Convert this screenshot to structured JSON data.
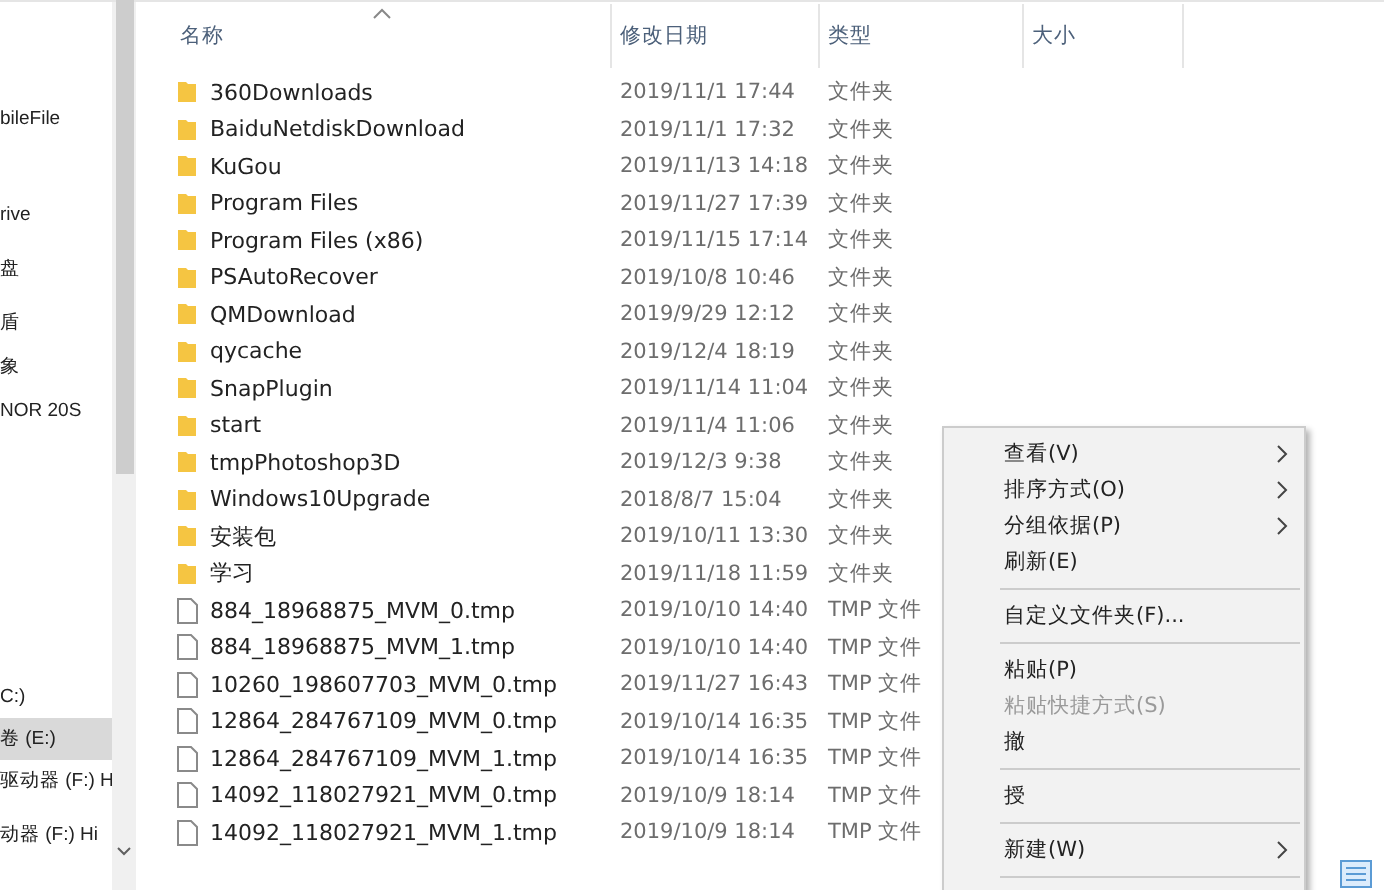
{
  "sidebar": {
    "items": [
      {
        "label": "bileFile",
        "selected": false
      },
      {
        "label": "rive",
        "selected": false
      },
      {
        "label": "盘",
        "selected": false
      },
      {
        "label": "盾",
        "selected": false
      },
      {
        "label": "象",
        "selected": false
      },
      {
        "label": "NOR 20S",
        "selected": false
      },
      {
        "label": "C:)",
        "selected": false
      },
      {
        "label": "卷 (E:)",
        "selected": true
      },
      {
        "label": "驱动器 (F:) H",
        "selected": false
      },
      {
        "label": "动器 (F:) Hi",
        "selected": false
      }
    ]
  },
  "table": {
    "columns": [
      {
        "label": "名称",
        "sorted": true
      },
      {
        "label": "修改日期",
        "sorted": false
      },
      {
        "label": "类型",
        "sorted": false
      },
      {
        "label": "大小",
        "sorted": false
      }
    ],
    "rows": [
      {
        "kind": "folder",
        "name": "360Downloads",
        "date": "2019/11/1 17:44",
        "type": "文件夹"
      },
      {
        "kind": "folder",
        "name": "BaiduNetdiskDownload",
        "date": "2019/11/1 17:32",
        "type": "文件夹"
      },
      {
        "kind": "folder",
        "name": "KuGou",
        "date": "2019/11/13 14:18",
        "type": "文件夹"
      },
      {
        "kind": "folder",
        "name": "Program Files",
        "date": "2019/11/27 17:39",
        "type": "文件夹"
      },
      {
        "kind": "folder",
        "name": "Program Files (x86)",
        "date": "2019/11/15 17:14",
        "type": "文件夹"
      },
      {
        "kind": "folder",
        "name": "PSAutoRecover",
        "date": "2019/10/8 10:46",
        "type": "文件夹"
      },
      {
        "kind": "folder",
        "name": "QMDownload",
        "date": "2019/9/29 12:12",
        "type": "文件夹"
      },
      {
        "kind": "folder",
        "name": "qycache",
        "date": "2019/12/4 18:19",
        "type": "文件夹"
      },
      {
        "kind": "folder",
        "name": "SnapPlugin",
        "date": "2019/11/14 11:04",
        "type": "文件夹"
      },
      {
        "kind": "folder",
        "name": "start",
        "date": "2019/11/4 11:06",
        "type": "文件夹"
      },
      {
        "kind": "folder",
        "name": "tmpPhotoshop3D",
        "date": "2019/12/3 9:38",
        "type": "文件夹"
      },
      {
        "kind": "folder",
        "name": "Windows10Upgrade",
        "date": "2018/8/7 15:04",
        "type": "文件夹"
      },
      {
        "kind": "folder",
        "name": "安装包",
        "date": "2019/10/11 13:30",
        "type": "文件夹"
      },
      {
        "kind": "folder",
        "name": "学习",
        "date": "2019/11/18 11:59",
        "type": "文件夹"
      },
      {
        "kind": "file",
        "name": "884_18968875_MVM_0.tmp",
        "date": "2019/10/10 14:40",
        "type": "TMP 文件"
      },
      {
        "kind": "file",
        "name": "884_18968875_MVM_1.tmp",
        "date": "2019/10/10 14:40",
        "type": "TMP 文件"
      },
      {
        "kind": "file",
        "name": "10260_198607703_MVM_0.tmp",
        "date": "2019/11/27 16:43",
        "type": "TMP 文件"
      },
      {
        "kind": "file",
        "name": "12864_284767109_MVM_0.tmp",
        "date": "2019/10/14 16:35",
        "type": "TMP 文件"
      },
      {
        "kind": "file",
        "name": "12864_284767109_MVM_1.tmp",
        "date": "2019/10/14 16:35",
        "type": "TMP 文件"
      },
      {
        "kind": "file",
        "name": "14092_118027921_MVM_0.tmp",
        "date": "2019/10/9 18:14",
        "type": "TMP 文件"
      },
      {
        "kind": "file",
        "name": "14092_118027921_MVM_1.tmp",
        "date": "2019/10/9 18:14",
        "type": "TMP 文件"
      }
    ]
  },
  "context_menu": {
    "items": [
      {
        "kind": "item",
        "label": "查看(V)",
        "submenu": true,
        "disabled": false
      },
      {
        "kind": "item",
        "label": "排序方式(O)",
        "submenu": true,
        "disabled": false
      },
      {
        "kind": "item",
        "label": "分组依据(P)",
        "submenu": true,
        "disabled": false
      },
      {
        "kind": "item",
        "label": "刷新(E)",
        "submenu": false,
        "disabled": false
      },
      {
        "kind": "separator"
      },
      {
        "kind": "item",
        "label": "自定义文件夹(F)...",
        "submenu": false,
        "disabled": false
      },
      {
        "kind": "separator"
      },
      {
        "kind": "item",
        "label": "粘贴(P)",
        "submenu": false,
        "disabled": false
      },
      {
        "kind": "item",
        "label": "粘贴快捷方式(S)",
        "submenu": false,
        "disabled": true
      },
      {
        "kind": "item",
        "label": "撤",
        "submenu": false,
        "disabled": false
      },
      {
        "kind": "separator"
      },
      {
        "kind": "item",
        "label": "授",
        "submenu": false,
        "disabled": false
      },
      {
        "kind": "separator"
      },
      {
        "kind": "item",
        "label": "新建(W)",
        "submenu": true,
        "disabled": false
      },
      {
        "kind": "separator"
      }
    ]
  }
}
